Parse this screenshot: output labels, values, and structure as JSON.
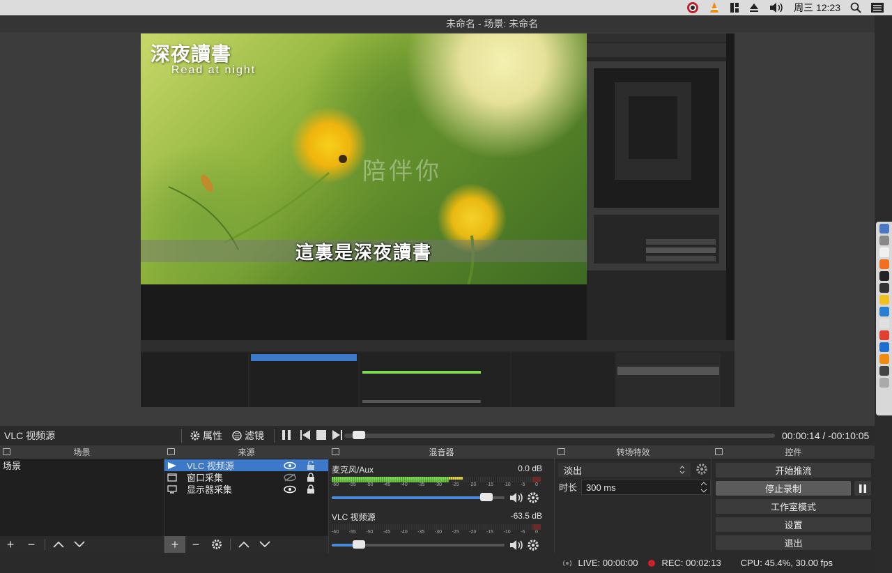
{
  "menubar": {
    "datetime": "周三 12:23"
  },
  "window": {
    "title": "未命名 - 场景: 未命名"
  },
  "video": {
    "logo_title": "深夜讀書",
    "logo_sub": "Read at night",
    "watermark": "陪伴你",
    "subtitle": "這裏是深夜讀書"
  },
  "source_toolbar": {
    "source_name": "VLC 视频源",
    "properties_label": "属性",
    "filters_label": "滤镜",
    "time": "00:00:14 / -00:10:05",
    "progress": 0.02
  },
  "scenes": {
    "title": "场景",
    "items": [
      "场景"
    ]
  },
  "sources": {
    "title": "来源",
    "items": [
      {
        "label": "VLC 视频源",
        "icon": "play-icon",
        "selected": true
      },
      {
        "label": "窗口采集",
        "icon": "window-icon",
        "selected": false
      },
      {
        "label": "显示器采集",
        "icon": "monitor-icon",
        "selected": false
      }
    ]
  },
  "mixer": {
    "title": "混音器",
    "channels": [
      {
        "name": "麦克风/Aux",
        "db": "0.0 dB",
        "level": 0.8,
        "volume": 0.92
      },
      {
        "name": "VLC 视频源",
        "db": "-63.5 dB",
        "level": 0.0,
        "volume": 0.16
      }
    ],
    "scale": [
      "-60",
      "-55",
      "-50",
      "-45",
      "-40",
      "-35",
      "-30",
      "-25",
      "-20",
      "-15",
      "-10",
      "-5",
      "0"
    ]
  },
  "transitions": {
    "title": "转场特效",
    "selected": "淡出",
    "duration_label": "时长",
    "duration_value": "300 ms"
  },
  "controls": {
    "title": "控件",
    "start_stream": "开始推流",
    "stop_record": "停止录制",
    "studio_mode": "工作室模式",
    "settings": "设置",
    "exit": "退出"
  },
  "status": {
    "live": "LIVE: 00:00:00",
    "rec": "REC: 00:02:13",
    "cpu": "CPU: 45.4%, 30.00 fps"
  },
  "colors": {
    "accent": "#3d79c9",
    "rec": "#d0202a",
    "meter_green": "#7ed957",
    "meter_yellow": "#e0d050"
  }
}
